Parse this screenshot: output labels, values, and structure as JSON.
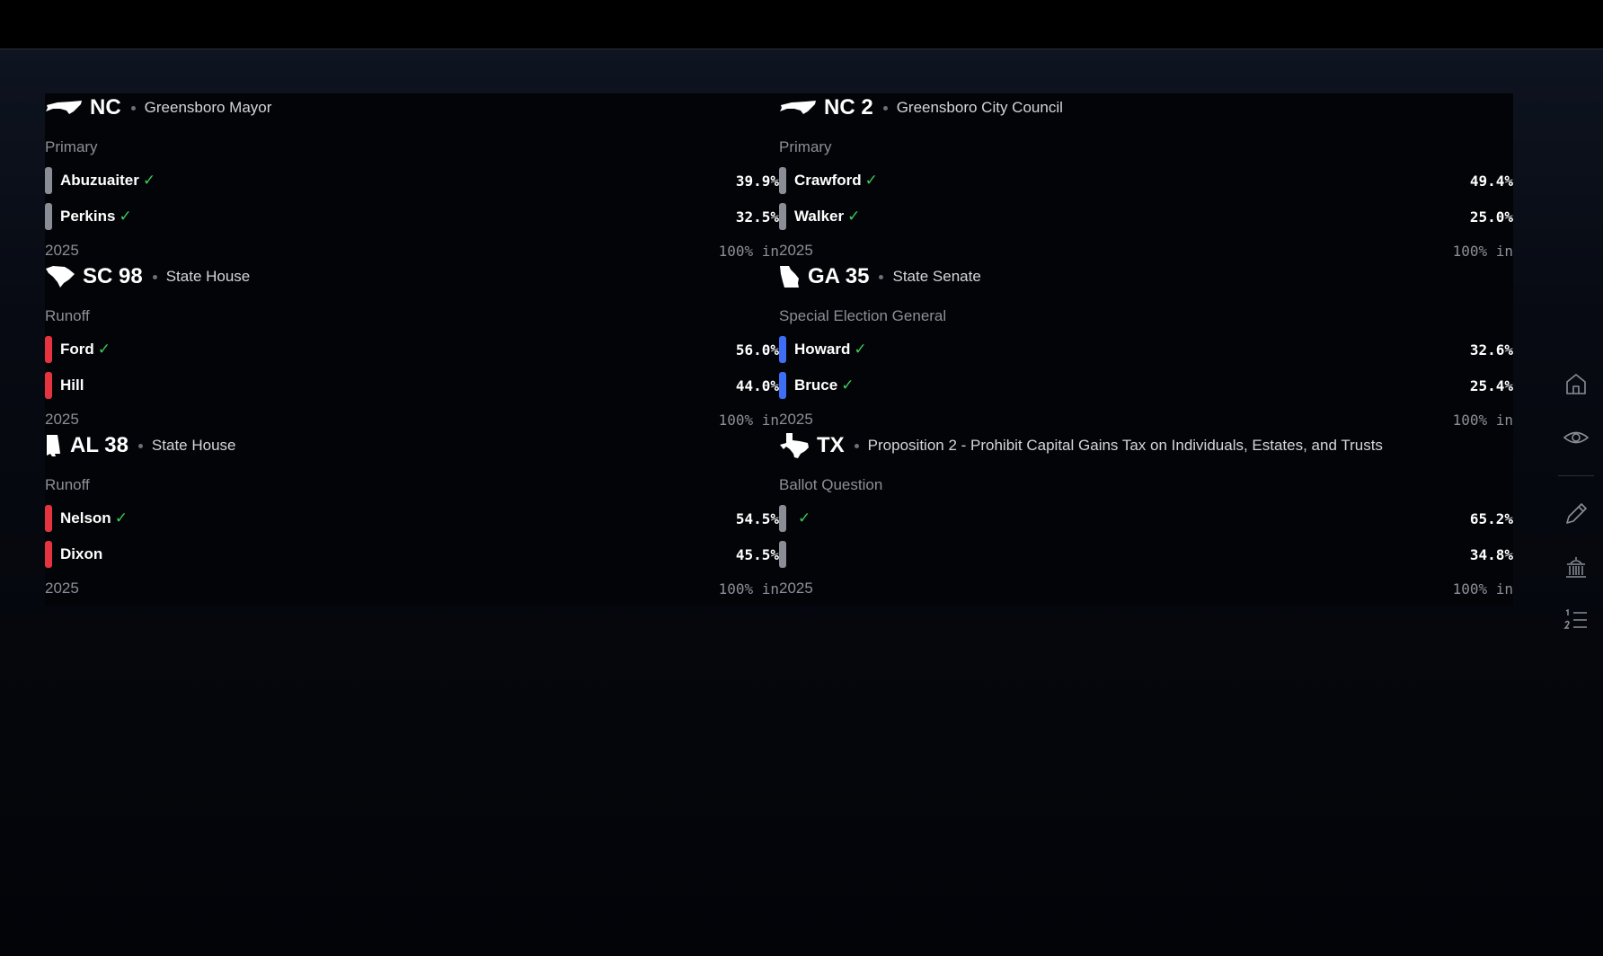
{
  "colors": {
    "background": "#05060a",
    "panel": "#030407",
    "party_gray": "#8a8d96",
    "party_red": "#e5333f",
    "party_blue": "#3d6ef5",
    "winner_check": "#3ec95b",
    "muted_text": "#8b8f98"
  },
  "races": [
    {
      "state_icon": "north-carolina-shape",
      "code": "NC",
      "office": "Greensboro Mayor",
      "election_type": "Primary",
      "candidates": [
        {
          "name": "Abuzuaiter",
          "check": "✓",
          "pct": "39.9%",
          "color": "gray"
        },
        {
          "name": "Perkins",
          "check": "✓",
          "pct": "32.5%",
          "color": "gray"
        }
      ],
      "year": "2025",
      "reporting": "100% in"
    },
    {
      "state_icon": "north-carolina-shape",
      "code": "NC 2",
      "office": "Greensboro City Council",
      "election_type": "Primary",
      "candidates": [
        {
          "name": "Crawford",
          "check": "✓",
          "pct": "49.4%",
          "color": "gray"
        },
        {
          "name": "Walker",
          "check": "✓",
          "pct": "25.0%",
          "color": "gray"
        }
      ],
      "year": "2025",
      "reporting": "100% in"
    },
    {
      "state_icon": "south-carolina-shape",
      "code": "SC 98",
      "office": "State House",
      "election_type": "Runoff",
      "candidates": [
        {
          "name": "Ford",
          "check": "✓",
          "pct": "56.0%",
          "color": "red"
        },
        {
          "name": "Hill",
          "check": "",
          "pct": "44.0%",
          "color": "red"
        }
      ],
      "year": "2025",
      "reporting": "100% in"
    },
    {
      "state_icon": "georgia-shape",
      "code": "GA 35",
      "office": "State Senate",
      "election_type": "Special Election General",
      "candidates": [
        {
          "name": "Howard",
          "check": "✓",
          "pct": "32.6%",
          "color": "blue"
        },
        {
          "name": "Bruce",
          "check": "✓",
          "pct": "25.4%",
          "color": "blue"
        }
      ],
      "year": "2025",
      "reporting": "100% in"
    },
    {
      "state_icon": "alabama-shape",
      "code": "AL 38",
      "office": "State House",
      "election_type": "Runoff",
      "candidates": [
        {
          "name": "Nelson",
          "check": "✓",
          "pct": "54.5%",
          "color": "red"
        },
        {
          "name": "Dixon",
          "check": "",
          "pct": "45.5%",
          "color": "red"
        }
      ],
      "year": "2025",
      "reporting": "100% in"
    },
    {
      "state_icon": "texas-shape",
      "code": "TX",
      "office": "Proposition 2 - Prohibit Capital Gains Tax on Individuals, Estates, and Trusts",
      "election_type": "Ballot Question",
      "candidates": [
        {
          "name": "",
          "check": "✓",
          "pct": "65.2%",
          "color": "gray"
        },
        {
          "name": "",
          "check": "",
          "pct": "34.8%",
          "color": "gray"
        }
      ],
      "year": "2025",
      "reporting": "100% in"
    }
  ],
  "sidebar": {
    "icons": [
      "home-icon",
      "eye-icon",
      "pencil-icon",
      "capitol-building-icon",
      "numbered-list-icon"
    ]
  }
}
